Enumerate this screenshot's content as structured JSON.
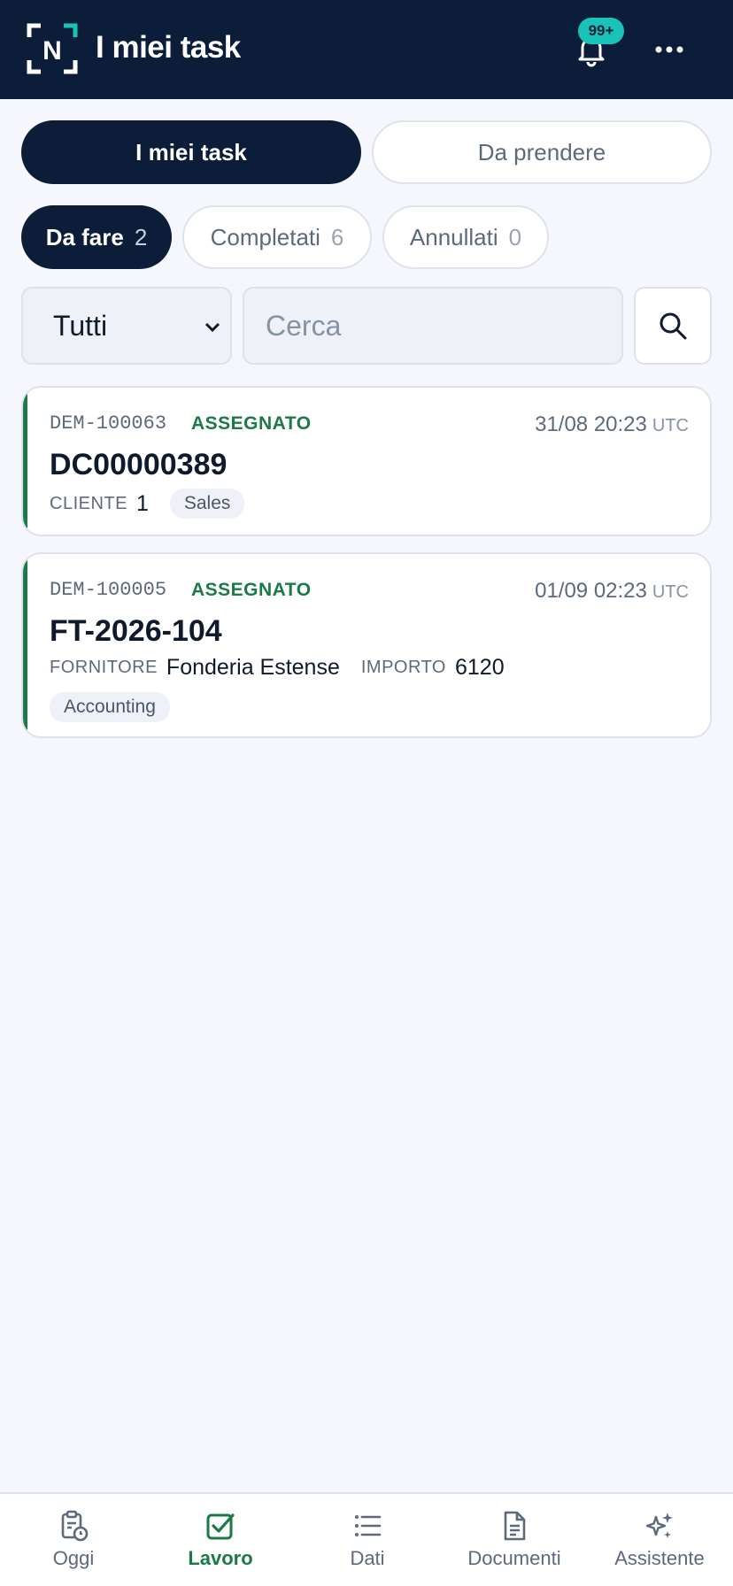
{
  "header": {
    "title": "I miei task",
    "notifications_badge": "99+",
    "logo_letter": "N",
    "accent": "#19c3b7",
    "background": "#0b1d38"
  },
  "segments": {
    "active_label": "I miei task",
    "inactive_label": "Da prendere"
  },
  "filter_chips": [
    {
      "label": "Da fare",
      "count": "2",
      "active": true
    },
    {
      "label": "Completati",
      "count": "6",
      "active": false
    },
    {
      "label": "Annullati",
      "count": "0",
      "active": false
    }
  ],
  "filter": {
    "select_value": "Tutti",
    "search_placeholder": "Cerca"
  },
  "tasks": [
    {
      "id": "DEM-100063",
      "status": "ASSEGNATO",
      "timestamp": "31/08 20:23",
      "tz": "UTC",
      "title": "DC00000389",
      "meta": [
        {
          "label": "CLIENTE",
          "value": "1"
        }
      ],
      "tag": "Sales"
    },
    {
      "id": "DEM-100005",
      "status": "ASSEGNATO",
      "timestamp": "01/09 02:23",
      "tz": "UTC",
      "title": "FT-2026-104",
      "meta": [
        {
          "label": "FORNITORE",
          "value": "Fonderia Estense"
        },
        {
          "label": "IMPORTO",
          "value": "6120"
        }
      ],
      "tag": "Accounting"
    }
  ],
  "bottom_nav": [
    {
      "label": "Oggi",
      "icon": "clipboard-clock-icon",
      "active": false
    },
    {
      "label": "Lavoro",
      "icon": "checkbox-icon",
      "active": true
    },
    {
      "label": "Dati",
      "icon": "list-icon",
      "active": false
    },
    {
      "label": "Documenti",
      "icon": "document-icon",
      "active": false
    },
    {
      "label": "Assistente",
      "icon": "sparkle-icon",
      "active": false
    }
  ],
  "colors": {
    "status_green": "#1b7a45",
    "navy": "#0b1d38",
    "page_bg": "#f5f7fc"
  }
}
